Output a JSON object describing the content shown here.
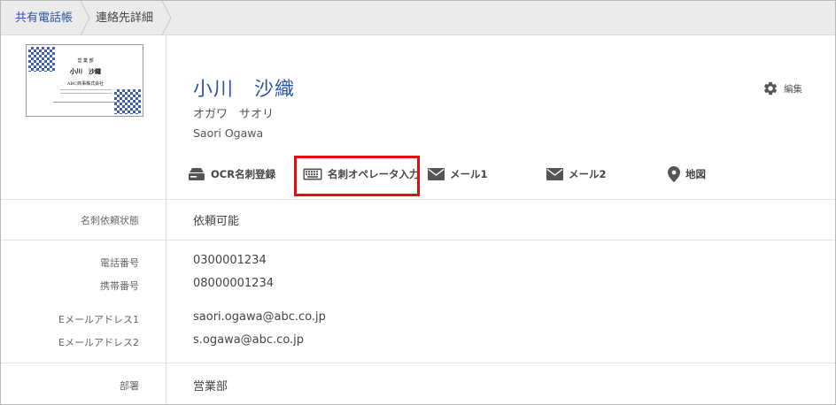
{
  "breadcrumb": {
    "root": "共有電話帳",
    "current": "連絡先詳細"
  },
  "business_card": {
    "department": "営 業 部",
    "name": "小川　沙織",
    "company": "ABC商事株式会社"
  },
  "contact": {
    "name": "小川　沙織",
    "kana": "オガワ　サオリ",
    "roman": "Saori Ogawa"
  },
  "edit": {
    "label": "編集",
    "icon": "gear-icon"
  },
  "actions": [
    {
      "label": "OCR名刺登録",
      "icon": "scanner-icon"
    },
    {
      "label": "名刺オペレータ入力",
      "icon": "keyboard-icon"
    },
    {
      "label": "メール1",
      "icon": "envelope-icon"
    },
    {
      "label": "メール2",
      "icon": "envelope-icon"
    },
    {
      "label": "地図",
      "icon": "map-pin-icon"
    }
  ],
  "fields": {
    "request_status": {
      "label": "名刺依頼状態",
      "value": "依頼可能"
    },
    "phone": {
      "label": "電話番号",
      "value": "0300001234"
    },
    "mobile": {
      "label": "携帯番号",
      "value": "08000001234"
    },
    "email1": {
      "label": "Eメールアドレス1",
      "value": "saori.ogawa@abc.co.jp"
    },
    "email2": {
      "label": "Eメールアドレス2",
      "value": "s.ogawa@abc.co.jp"
    },
    "department": {
      "label": "部署",
      "value": "営業部"
    }
  },
  "colors": {
    "link": "#2b55a5",
    "highlight": "#e01010",
    "icon": "#555555"
  }
}
